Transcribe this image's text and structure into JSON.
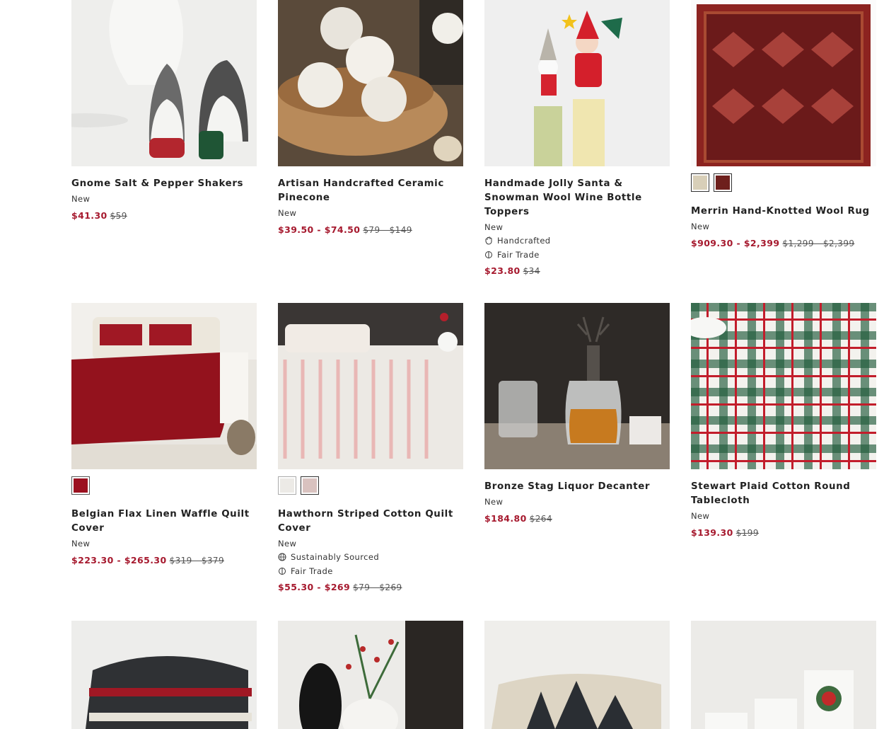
{
  "products": [
    {
      "name": "Gnome Salt & Pepper Shakers",
      "badge": "New",
      "sale": "$41.30",
      "orig": "$59"
    },
    {
      "name": "Artisan Handcrafted Ceramic Pinecone",
      "badge": "New",
      "sale": "$39.50 - $74.50",
      "orig": "$79 - $149"
    },
    {
      "name": "Handmade Jolly Santa & Snowman Wool Wine Bottle Toppers",
      "badge": "New",
      "attrs": [
        "Handcrafted",
        "Fair Trade"
      ],
      "sale": "$23.80",
      "orig": "$34"
    },
    {
      "name": "Merrin Hand-Knotted Wool Rug",
      "badge": "New",
      "sale": "$909.30 - $2,399",
      "orig": "$1,299 - $2,399",
      "swatch_colors": [
        "#d8cfb8",
        "#6e1f1c"
      ]
    },
    {
      "name": "Belgian Flax Linen Waffle Quilt Cover",
      "badge": "New",
      "sale": "$223.30 - $265.30",
      "orig": "$319 - $379",
      "swatch_colors": [
        "#9b1020"
      ]
    },
    {
      "name": "Hawthorn Striped Cotton Quilt Cover",
      "badge": "New",
      "attrs": [
        "Sustainably Sourced",
        "Fair Trade"
      ],
      "sale": "$55.30 - $269",
      "orig": "$79 - $269",
      "swatch_colors": [
        "#eceae6",
        "#d9c2bf"
      ]
    },
    {
      "name": "Bronze Stag Liquor Decanter",
      "badge": "New",
      "sale": "$184.80",
      "orig": "$264"
    },
    {
      "name": "Stewart Plaid Cotton Round Tablecloth",
      "badge": "New",
      "sale": "$139.30",
      "orig": "$199"
    }
  ],
  "colors": {
    "sale": "#a6192e"
  }
}
